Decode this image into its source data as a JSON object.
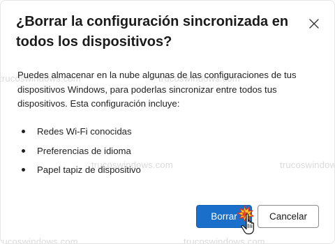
{
  "dialog": {
    "title": "¿Borrar la configuración sincronizada en todos los dispositivos?",
    "description": "Puedes almacenar en la nube algunas de las configuraciones de tus dispositivos Windows, para poderlas sincronizar entre todos tus dispositivos. Esta configuración incluye:",
    "items": [
      {
        "label": "Redes Wi-Fi conocidas"
      },
      {
        "label": "Preferencias de idioma"
      },
      {
        "label": "Papel tapiz de dispositivo"
      }
    ],
    "primary_button": "Borrar",
    "secondary_button": "Cancelar",
    "close_icon": "close-icon"
  },
  "watermark": {
    "text": "trucoswindows.com"
  },
  "colors": {
    "primary": "#1a6fcb",
    "text": "#1f1f1f",
    "background": "#ffffff"
  }
}
